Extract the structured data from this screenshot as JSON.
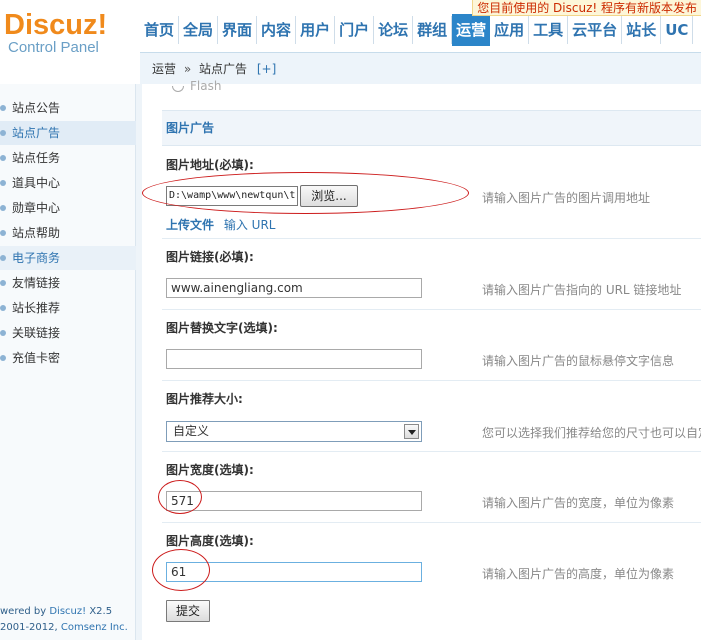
{
  "logo": {
    "brand": "Discuz",
    "exclaim": "!",
    "subtitle": "Control Panel"
  },
  "update_notice": "您目前使用的 Discuz! 程序有新版本发布",
  "nav": [
    "首页",
    "全局",
    "界面",
    "内容",
    "用户",
    "门户",
    "论坛",
    "群组",
    "运营",
    "应用",
    "工具",
    "云平台",
    "站长",
    "UC"
  ],
  "nav_active": "运营",
  "breadcrumb": {
    "section": "运营",
    "separator": "»",
    "page": "站点广告",
    "add": "[+]"
  },
  "sidebar": {
    "items": [
      "站点公告",
      "站点广告",
      "站点任务",
      "道具中心",
      "勋章中心",
      "站点帮助",
      "电子商务",
      "友情链接",
      "站长推荐",
      "关联链接",
      "充值卡密"
    ],
    "active": "站点广告",
    "group": "电子商务"
  },
  "footer": {
    "line1_prefix": "wered by ",
    "line1_brand": "Discuz!",
    "line1_version": " X2.5",
    "line2_prefix": "2001-2012, ",
    "line2_brand": "Comsenz Inc."
  },
  "form": {
    "radio_stub_label": "Flash",
    "section_title": "图片广告",
    "image_url": {
      "label": "图片地址(必填):",
      "value": "D:\\wamp\\www\\newtqun\\t",
      "browse": "浏览...",
      "hint": "请输入图片广告的图片调用地址",
      "upload_link": "上传文件",
      "url_link": "输入 URL"
    },
    "image_link": {
      "label": "图片链接(必填):",
      "value": "www.ainengliang.com",
      "hint": "请输入图片广告指向的 URL 链接地址"
    },
    "image_alt": {
      "label": "图片替换文字(选填):",
      "value": "",
      "hint": "请输入图片广告的鼠标悬停文字信息"
    },
    "image_size": {
      "label": "图片推荐大小:",
      "value": "自定义",
      "hint": "您可以选择我们推荐给您的尺寸也可以自定义"
    },
    "image_width": {
      "label": "图片宽度(选填):",
      "value": "571",
      "hint": "请输入图片广告的宽度，单位为像素"
    },
    "image_height": {
      "label": "图片高度(选填):",
      "value": "61",
      "hint": "请输入图片广告的高度，单位为像素"
    },
    "submit": "提交"
  },
  "colors": {
    "brand_orange": "#f08a1c",
    "nav_blue": "#2f74b0",
    "active_nav_bg": "#2b85c9",
    "annotation_red": "#cc1b1b"
  }
}
